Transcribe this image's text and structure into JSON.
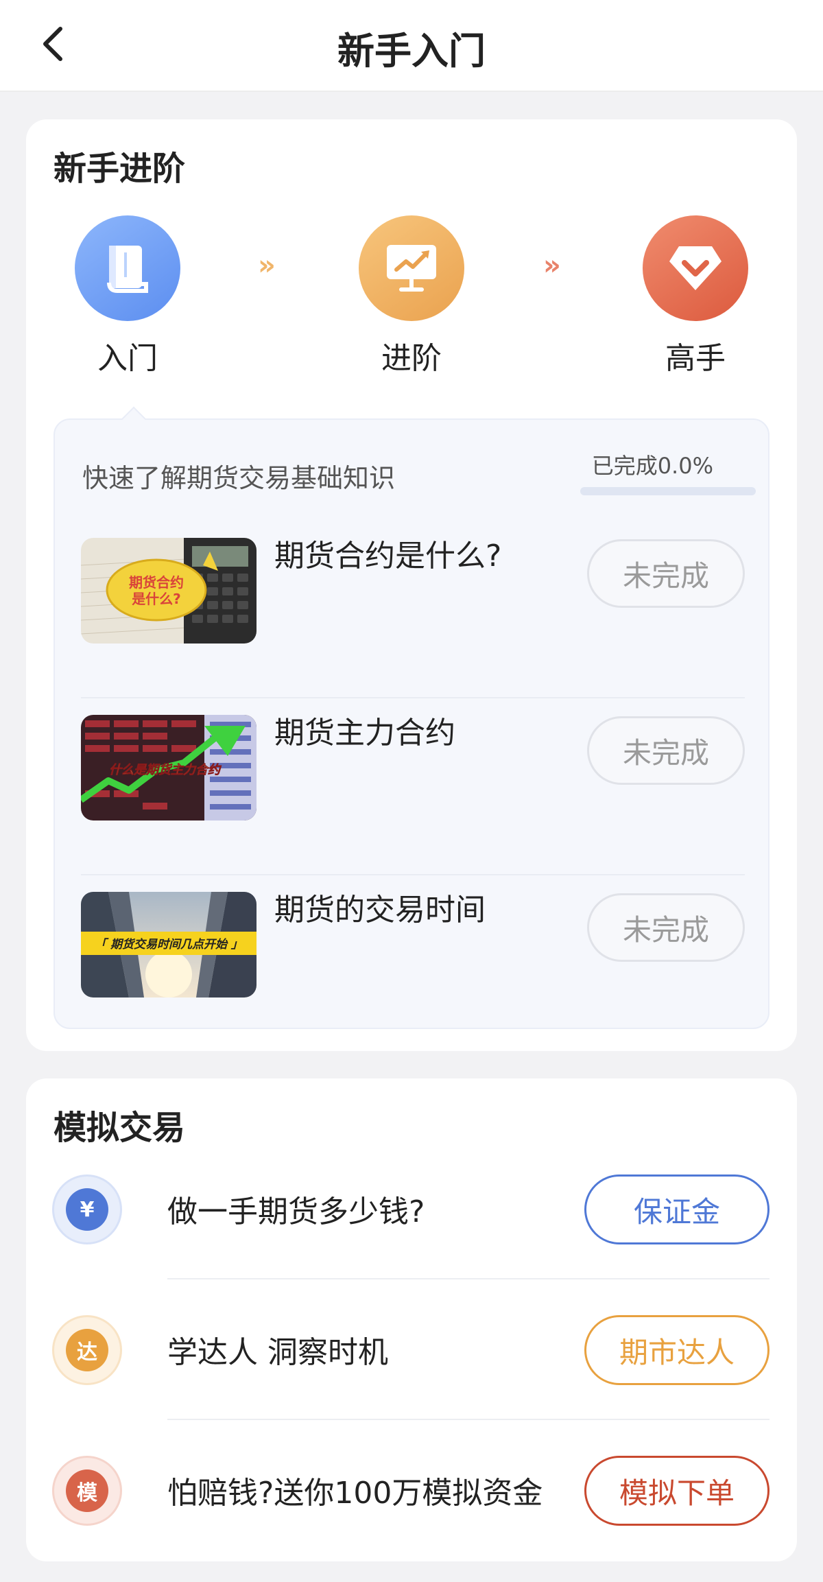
{
  "nav": {
    "title": "新手入门"
  },
  "advance": {
    "title": "新手进阶",
    "steps": [
      {
        "label": "入门",
        "icon": "book-icon",
        "color": "#6c9bf3"
      },
      {
        "label": "进阶",
        "icon": "chart-board-icon",
        "color": "#efb060"
      },
      {
        "label": "高手",
        "icon": "diamond-icon",
        "color": "#e46c4e"
      }
    ],
    "arrow": "»",
    "course": {
      "description": "快速了解期货交易基础知识",
      "progress_text": "已完成0.0%",
      "progress": 0.0,
      "items": [
        {
          "name": "期货合约是什么?",
          "status": "未完成",
          "thumb_text": [
            "期货合约",
            "是什么?"
          ]
        },
        {
          "name": "期货主力合约",
          "status": "未完成",
          "thumb_text": "什么是期货主力合约"
        },
        {
          "name": "期货的交易时间",
          "status": "未完成",
          "thumb_text": "「 期货交易时间几点开始 」"
        }
      ]
    }
  },
  "simulation": {
    "title": "模拟交易",
    "items": [
      {
        "icon_text": "¥",
        "text": "做一手期货多少钱?",
        "button": "保证金",
        "color": "#4f78d6"
      },
      {
        "icon_text": "达",
        "text": "学达人 洞察时机",
        "button": "期市达人",
        "color": "#e8a13f"
      },
      {
        "icon_text": "模",
        "text": "怕赔钱?送你100万模拟资金",
        "button": "模拟下单",
        "color": "#c9492f"
      }
    ]
  }
}
